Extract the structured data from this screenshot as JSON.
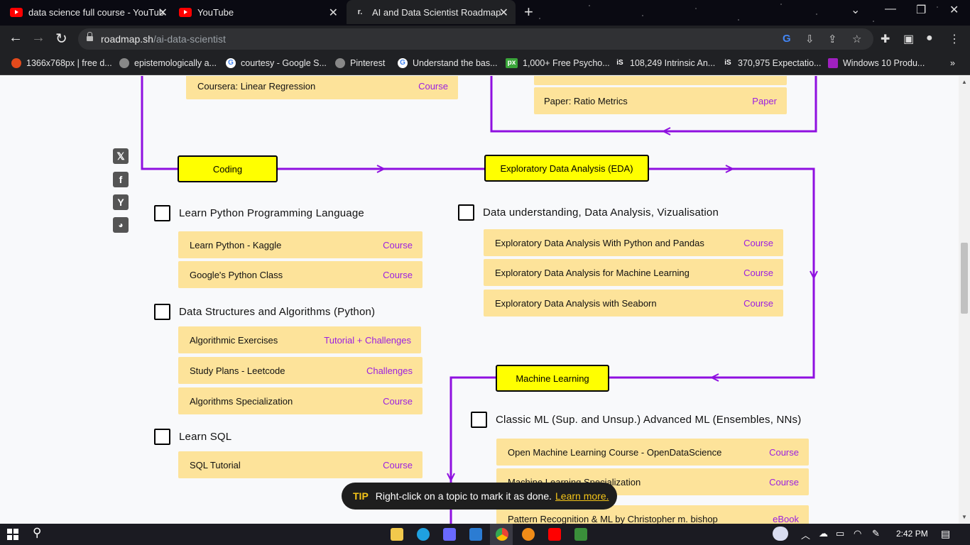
{
  "browser": {
    "tabs": [
      {
        "title": "data science full course - YouTub",
        "icon": "youtube-icon"
      },
      {
        "title": "YouTube",
        "icon": "youtube-icon"
      },
      {
        "title": "AI and Data Scientist Roadmap",
        "icon": "roadmap-icon"
      }
    ],
    "url_host": "roadmap.sh",
    "url_path": "/ai-data-scientist",
    "bookmarks": [
      "1366x768px | free d...",
      "epistemologically a...",
      "courtesy - Google S...",
      "Pinterest",
      "Understand the bas...",
      "1,000+ Free Psycho...",
      "108,249 Intrinsic An...",
      "370,975 Expectatio...",
      "Windows 10 Produ..."
    ]
  },
  "roadmap": {
    "top_left_resource": {
      "title": "Coursera: Linear Regression",
      "type": "Course"
    },
    "top_right_resource": {
      "title": "Paper: Ratio Metrics",
      "type": "Paper"
    },
    "topics": {
      "coding": "Coding",
      "eda": "Exploratory Data Analysis (EDA)",
      "ml": "Machine Learning"
    },
    "coding_groups": [
      {
        "label": "Learn Python Programming Language",
        "resources": [
          {
            "title": "Learn Python - Kaggle",
            "type": "Course"
          },
          {
            "title": "Google's Python Class",
            "type": "Course"
          }
        ]
      },
      {
        "label": "Data Structures and Algorithms (Python)",
        "resources": [
          {
            "title": "Algorithmic Exercises",
            "type": "Tutorial + Challenges"
          },
          {
            "title": "Study Plans - Leetcode",
            "type": "Challenges"
          },
          {
            "title": "Algorithms Specialization",
            "type": "Course"
          }
        ]
      },
      {
        "label": "Learn SQL",
        "resources": [
          {
            "title": "SQL Tutorial",
            "type": "Course"
          }
        ]
      }
    ],
    "eda_group": {
      "label": "Data understanding, Data Analysis, Vizualisation",
      "resources": [
        {
          "title": "Exploratory Data Analysis With Python and Pandas",
          "type": "Course"
        },
        {
          "title": "Exploratory Data Analysis for Machine Learning",
          "type": "Course"
        },
        {
          "title": "Exploratory Data Analysis with Seaborn",
          "type": "Course"
        }
      ]
    },
    "ml_group": {
      "label": "Classic ML (Sup. and Unsup.) Advanced ML (Ensembles, NNs)",
      "resources": [
        {
          "title": "Open Machine Learning Course - OpenDataScience",
          "type": "Course"
        },
        {
          "title": "Machine Learning Specialization",
          "type": "Course"
        },
        {
          "title": "Pattern Recognition & ML by Christopher m. bishop",
          "type": "eBook"
        }
      ]
    }
  },
  "tip": {
    "badge": "TIP",
    "text": "Right-click on a topic to mark it as done.",
    "link": "Learn more."
  },
  "taskbar": {
    "time": "2:42 PM"
  },
  "colors": {
    "line": "#8f10e0",
    "topic": "#ffff00",
    "resource": "#fde39a",
    "resource_type": "#9b1fe0"
  }
}
